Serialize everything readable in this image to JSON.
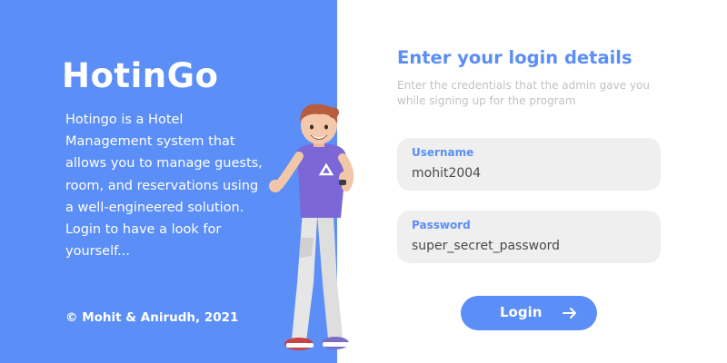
{
  "brand": {
    "name": "HotinGo",
    "description": "Hotingo is a Hotel Management system that allows you to manage guests, room, and reservations using a well-engineered solution. Login to have a look for yourself...",
    "copyright": "© Mohit & Anirudh, 2021"
  },
  "login": {
    "title": "Enter your login details",
    "subtitle": "Enter the credentials that the admin gave you while signing up for the program",
    "username": {
      "label": "Username",
      "value": "mohit2004"
    },
    "password": {
      "label": "Password",
      "value": "super_secret_password"
    },
    "button_label": "Login",
    "button_icon": "arrow-right-icon"
  },
  "colors": {
    "accent": "#5b8ef6",
    "field_bg": "#efefef",
    "subtitle": "#c2c2c2",
    "text": "#4a4a4a"
  }
}
